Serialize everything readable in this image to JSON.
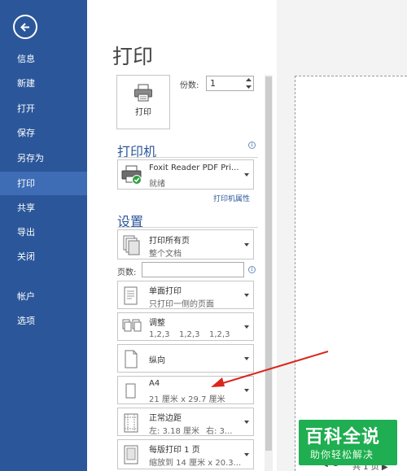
{
  "nav": {
    "items": [
      "信息",
      "新建",
      "打开",
      "保存",
      "另存为",
      "打印",
      "共享",
      "导出",
      "关闭",
      "帐户",
      "选项"
    ],
    "active": "打印"
  },
  "page_title": "打印",
  "print_button": {
    "label": "打印"
  },
  "copies": {
    "label": "份数:",
    "value": "1"
  },
  "printer": {
    "section_title": "打印机",
    "name": "Foxit Reader PDF Pri...",
    "status": "就绪",
    "properties_link": "打印机属性"
  },
  "settings": {
    "section_title": "设置",
    "range": {
      "main": "打印所有页",
      "sub": "整个文档"
    },
    "pages_label": "页数:",
    "pages_value": "",
    "sides": {
      "main": "单面打印",
      "sub": "只打印一侧的页面"
    },
    "collate": {
      "main": "调整",
      "sub": [
        "1,2,3",
        "1,2,3",
        "1,2,3"
      ]
    },
    "orientation": {
      "main": "纵向"
    },
    "paper": {
      "main": "A4",
      "sub": "21 厘米 x 29.7 厘米"
    },
    "margins": {
      "main": "正常边距",
      "sub_left": "左: 3.18 厘米",
      "sub_right": "右: 3..."
    },
    "per_sheet": {
      "main": "每版打印 1 页",
      "sub": "缩放到 14 厘米 x 20.3..."
    }
  },
  "preview": {
    "pager_prefix": "◀",
    "pager_value": "1",
    "pager_suffix": "共 1 页 ▶"
  },
  "watermark": {
    "main": "百科全说",
    "sub": "助你轻松解决"
  },
  "colors": {
    "nav_bg": "#2b579a",
    "nav_active": "#3e6db5",
    "accent": "#2b579a",
    "arrow": "#d9261c",
    "watermark": "#1fae51"
  }
}
